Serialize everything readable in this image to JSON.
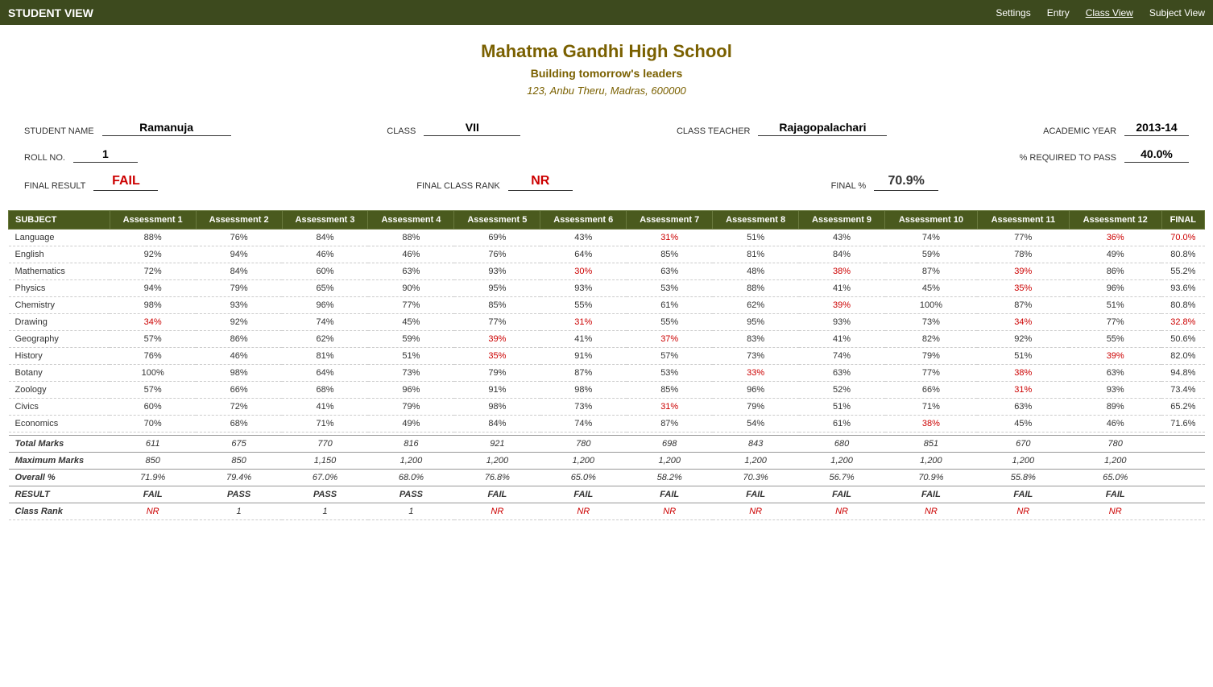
{
  "header": {
    "title": "STUDENT VIEW",
    "nav": {
      "settings": "Settings",
      "entry": "Entry",
      "class_view": "Class View",
      "subject_view": "Subject View"
    }
  },
  "school": {
    "name": "Mahatma Gandhi High School",
    "motto": "Building tomorrow's leaders",
    "address": "123, Anbu Theru, Madras, 600000"
  },
  "student": {
    "name": "Ramanuja",
    "class": "VII",
    "teacher": "Rajagopalachari",
    "academic_year": "2013-14",
    "roll_no": "1",
    "pass_percent": "40.0%",
    "final_result": "FAIL",
    "final_class_rank": "NR",
    "final_percent": "70.9%"
  },
  "table": {
    "headers": [
      "SUBJECT",
      "Assessment 1",
      "Assessment 2",
      "Assessment 3",
      "Assessment 4",
      "Assessment 5",
      "Assessment 6",
      "Assessment 7",
      "Assessment 8",
      "Assessment 9",
      "Assessment 10",
      "Assessment 11",
      "Assessment 12",
      "FINAL"
    ],
    "rows": [
      {
        "subject": "Language",
        "vals": [
          "88%",
          "76%",
          "84%",
          "88%",
          "69%",
          "43%",
          "31%",
          "51%",
          "43%",
          "74%",
          "77%",
          "36%",
          "70.0%"
        ],
        "red": [
          6,
          11,
          12
        ]
      },
      {
        "subject": "English",
        "vals": [
          "92%",
          "94%",
          "46%",
          "46%",
          "76%",
          "64%",
          "85%",
          "81%",
          "84%",
          "59%",
          "78%",
          "49%",
          "80.8%"
        ],
        "red": []
      },
      {
        "subject": "Mathematics",
        "vals": [
          "72%",
          "84%",
          "60%",
          "63%",
          "93%",
          "30%",
          "63%",
          "48%",
          "38%",
          "87%",
          "39%",
          "86%",
          "55.2%"
        ],
        "red": [
          5,
          8,
          10
        ]
      },
      {
        "subject": "Physics",
        "vals": [
          "94%",
          "79%",
          "65%",
          "90%",
          "95%",
          "93%",
          "53%",
          "88%",
          "41%",
          "45%",
          "35%",
          "96%",
          "93.6%"
        ],
        "red": [
          10
        ]
      },
      {
        "subject": "Chemistry",
        "vals": [
          "98%",
          "93%",
          "96%",
          "77%",
          "85%",
          "55%",
          "61%",
          "62%",
          "39%",
          "100%",
          "87%",
          "51%",
          "80.8%"
        ],
        "red": [
          8
        ]
      },
      {
        "subject": "Drawing",
        "vals": [
          "34%",
          "92%",
          "74%",
          "45%",
          "77%",
          "31%",
          "55%",
          "95%",
          "93%",
          "73%",
          "34%",
          "77%",
          "32.8%"
        ],
        "red": [
          0,
          5,
          10,
          12
        ]
      },
      {
        "subject": "Geography",
        "vals": [
          "57%",
          "86%",
          "62%",
          "59%",
          "39%",
          "41%",
          "37%",
          "83%",
          "41%",
          "82%",
          "92%",
          "55%",
          "50.6%"
        ],
        "red": [
          4,
          6
        ]
      },
      {
        "subject": "History",
        "vals": [
          "76%",
          "46%",
          "81%",
          "51%",
          "35%",
          "91%",
          "57%",
          "73%",
          "74%",
          "79%",
          "51%",
          "39%",
          "82.0%"
        ],
        "red": [
          4,
          11
        ]
      },
      {
        "subject": "Botany",
        "vals": [
          "100%",
          "98%",
          "64%",
          "73%",
          "79%",
          "87%",
          "53%",
          "33%",
          "63%",
          "77%",
          "38%",
          "63%",
          "94.8%"
        ],
        "red": [
          7,
          10
        ]
      },
      {
        "subject": "Zoology",
        "vals": [
          "57%",
          "66%",
          "68%",
          "96%",
          "91%",
          "98%",
          "85%",
          "96%",
          "52%",
          "66%",
          "31%",
          "93%",
          "73.4%"
        ],
        "red": [
          10
        ]
      },
      {
        "subject": "Civics",
        "vals": [
          "60%",
          "72%",
          "41%",
          "79%",
          "98%",
          "73%",
          "31%",
          "79%",
          "51%",
          "71%",
          "63%",
          "89%",
          "65.2%"
        ],
        "red": [
          6
        ]
      },
      {
        "subject": "Economics",
        "vals": [
          "70%",
          "68%",
          "71%",
          "49%",
          "84%",
          "74%",
          "87%",
          "54%",
          "61%",
          "38%",
          "45%",
          "46%",
          "71.6%"
        ],
        "red": [
          9
        ]
      }
    ],
    "summary": {
      "total_marks": {
        "label": "Total Marks",
        "vals": [
          "611",
          "675",
          "770",
          "816",
          "921",
          "780",
          "698",
          "843",
          "680",
          "851",
          "670",
          "780",
          ""
        ]
      },
      "max_marks": {
        "label": "Maximum Marks",
        "vals": [
          "850",
          "850",
          "1,150",
          "1,200",
          "1,200",
          "1,200",
          "1,200",
          "1,200",
          "1,200",
          "1,200",
          "1,200",
          "1,200",
          ""
        ]
      },
      "overall_pct": {
        "label": "Overall %",
        "vals": [
          "71.9%",
          "79.4%",
          "67.0%",
          "68.0%",
          "76.8%",
          "65.0%",
          "58.2%",
          "70.3%",
          "56.7%",
          "70.9%",
          "55.8%",
          "65.0%",
          ""
        ]
      },
      "result": {
        "label": "RESULT",
        "vals": [
          "FAIL",
          "PASS",
          "PASS",
          "PASS",
          "FAIL",
          "FAIL",
          "FAIL",
          "FAIL",
          "FAIL",
          "FAIL",
          "FAIL",
          "FAIL",
          ""
        ],
        "fails": [
          0,
          4,
          5,
          6,
          7,
          8,
          9,
          10,
          11
        ]
      },
      "class_rank": {
        "label": "Class Rank",
        "vals": [
          "NR",
          "1",
          "1",
          "1",
          "NR",
          "NR",
          "NR",
          "NR",
          "NR",
          "NR",
          "NR",
          "NR",
          ""
        ],
        "nrs": [
          0,
          4,
          5,
          6,
          7,
          8,
          9,
          10,
          11
        ]
      }
    }
  }
}
